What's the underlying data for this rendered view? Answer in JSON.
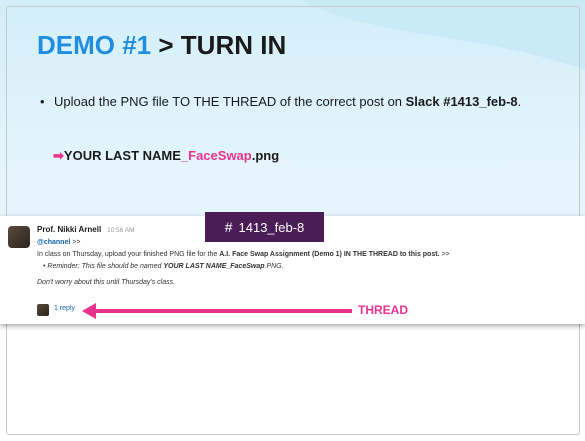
{
  "slide": {
    "title_highlight": "DEMO #1",
    "title_rest": "> TURN IN",
    "bullet_text": "Upload the PNG file TO THE THREAD of the correct post on ",
    "bullet_bold": "Slack #1413_feb-8",
    "bullet_end": ".",
    "arrow_glyph": "➡",
    "filename_part1": "YOUR LAST NAME",
    "filename_part2": "_FaceSwap",
    "filename_part3": ".png"
  },
  "slack": {
    "author": "Prof. Nikki Arnell",
    "time": "10:56 AM",
    "mention": "@channel",
    "mention_suffix": " >>",
    "line1_pre": "In class on Thursday, upload your finished PNG file for the ",
    "line1_bold": "A.I. Face Swap Assignment (Demo 1) IN THE THREAD to this post.",
    "line1_post": " >>",
    "reminder_label": "Reminder:",
    "reminder_text": " This file should be named ",
    "reminder_bold": "YOUR LAST NAME_FaceSwap",
    "reminder_end": ".PNG.",
    "note": "Don't worry about this until Thursday's class.",
    "reply_count": "1 reply"
  },
  "annotations": {
    "channel_hash": "#",
    "channel_name": "1413_feb-8",
    "thread_label": "THREAD"
  },
  "colors": {
    "accent_blue": "#1f8de0",
    "accent_pink": "#e8338e",
    "channel_bg": "#4a1d57",
    "link_blue": "#1264a3"
  }
}
